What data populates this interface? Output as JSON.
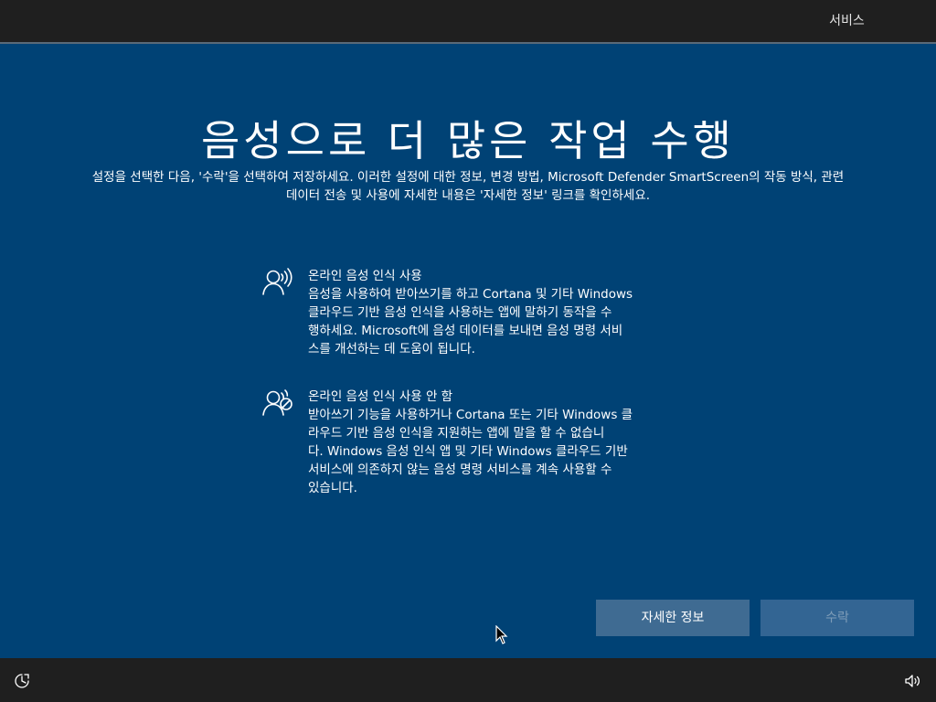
{
  "header": {
    "tab_label": "서비스"
  },
  "main": {
    "title": "음성으로 더 많은 작업 수행",
    "subtitle_line1": "설정을 선택한 다음, '수락'을 선택하여 저장하세요. 이러한 설정에 대한 정보, 변경 방법, Microsoft Defender SmartScreen의 작동 방식, 관련",
    "subtitle_line2": "데이터 전송 및 사용에 자세한 내용은 '자세한 정보' 링크를 확인하세요."
  },
  "options": [
    {
      "title": "온라인 음성 인식 사용",
      "desc_lines": [
        "음성을 사용하여 받아쓰기를 하고 Cortana 및 기타 Windows",
        "클라우드 기반 음성 인식을 사용하는 앱에 말하기 동작을 수",
        "행하세요. Microsoft에 음성 데이터를 보내면 음성 명령 서비",
        "스를 개선하는 데 도움이 됩니다."
      ],
      "icon": "speech-recognition-on-icon"
    },
    {
      "title": "온라인 음성 인식 사용 안 함",
      "desc_lines": [
        "받아쓰기 기능을 사용하거나 Cortana 또는 기타 Windows 클",
        "라우드 기반 음성 인식을 지원하는 앱에 말을 할 수 없습니",
        "다. Windows 음성 인식 앱 및 기타 Windows 클라우드 기반",
        "서비스에 의존하지 않는 음성 명령 서비스를 계속 사용할 수",
        "있습니다."
      ],
      "icon": "speech-recognition-off-icon"
    }
  ],
  "buttons": {
    "more_info": "자세한 정보",
    "accept": "수락"
  },
  "footer": {
    "ease_icon": "ease-of-access-icon",
    "volume_icon": "volume-icon"
  },
  "colors": {
    "background": "#004275",
    "bar": "#1f1f1f",
    "button_primary": "#3f6b92",
    "button_disabled": "#336593"
  }
}
